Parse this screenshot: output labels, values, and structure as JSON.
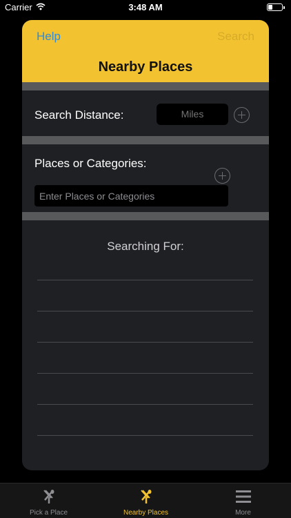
{
  "status_bar": {
    "carrier": "Carrier",
    "time": "3:48 AM",
    "battery_level": 0.3
  },
  "header": {
    "help_label": "Help",
    "search_label": "Search",
    "title": "Nearby Places"
  },
  "distance_row": {
    "label": "Search Distance:",
    "field_placeholder": "Miles",
    "add_icon": "plus-circle-icon"
  },
  "places_row": {
    "label": "Places or Categories:",
    "input_placeholder": "Enter Places or Categories",
    "input_value": "",
    "add_icon": "plus-circle-icon"
  },
  "results": {
    "title": "Searching For:",
    "items": [
      "",
      "",
      "",
      "",
      "",
      ""
    ]
  },
  "tab_bar": {
    "tabs": [
      {
        "label": "Pick a Place",
        "icon": "utensils-icon",
        "selected": false
      },
      {
        "label": "Nearby Places",
        "icon": "utensils-icon",
        "selected": true
      },
      {
        "label": "More",
        "icon": "menu-icon",
        "selected": false
      }
    ],
    "active_color": "#f2c230",
    "inactive_color": "#8e8e93"
  },
  "colors": {
    "accent": "#f2c230",
    "link": "#2f8bd8",
    "card": "#1f2023",
    "divider": "#58595b"
  }
}
